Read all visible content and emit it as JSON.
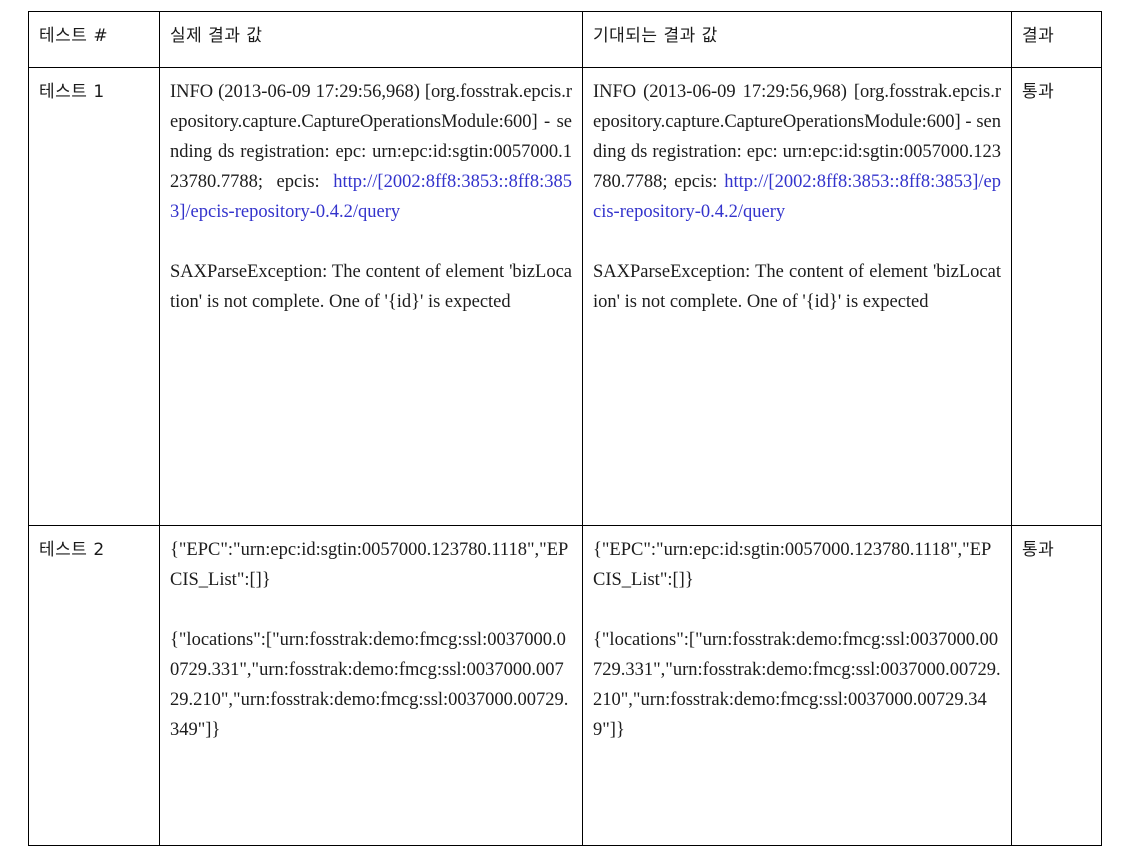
{
  "table": {
    "headers": {
      "test_number": "테스트 #",
      "actual_result": "실제 결과 값",
      "expected_result": "기대되는 결과 값",
      "result": "결과"
    },
    "rows": [
      {
        "test_number": "테스트 1",
        "result": "통과",
        "actual": {
          "block1_pre": "INFO (2013-06-09 17:29:56,968) [org.fosstrak.epcis.repository.capture.CaptureOperationsModule:600] - sending ds registration: epc: urn:epc:id:sgtin:0057000.123780.7788; epcis: ",
          "block1_link": "http://[2002:8ff8:3853::8ff8:3853]/epcis-repository-0.4.2/query",
          "block2": "SAXParseException: The content of element 'bizLocation' is not complete. One of '{id}' is expected"
        },
        "expected": {
          "block1_pre": "INFO (2013-06-09 17:29:56,968) [org.fosstrak.epcis.repository.capture.CaptureOperationsModule:600] - sending ds registration: epc: urn:epc:id:sgtin:0057000.123780.7788; epcis: ",
          "block1_link": "http://[2002:8ff8:3853::8ff8:3853]/epcis-repository-0.4.2/query",
          "block2": "SAXParseException: The content of element 'bizLocation' is not complete. One of '{id}' is expected"
        }
      },
      {
        "test_number": "테스트 2",
        "result": "통과",
        "actual": {
          "block1": "{\"EPC\":\"urn:epc:id:sgtin:0057000.123780.1118\",\"EPCIS_List\":[]}",
          "block2": "{\"locations\":[\"urn:fosstrak:demo:fmcg:ssl:0037000.00729.331\",\"urn:fosstrak:demo:fmcg:ssl:0037000.00729.210\",\"urn:fosstrak:demo:fmcg:ssl:0037000.00729.349\"]}"
        },
        "expected": {
          "block1": "{\"EPC\":\"urn:epc:id:sgtin:0057000.123780.1118\",\"EPCIS_List\":[]}",
          "block2": "{\"locations\":[\"urn:fosstrak:demo:fmcg:ssl:0037000.00729.331\",\"urn:fosstrak:demo:fmcg:ssl:0037000.00729.210\",\"urn:fosstrak:demo:fmcg:ssl:0037000.00729.349\"]}"
        }
      }
    ]
  },
  "colors": {
    "link": "#3333cc",
    "border": "#000000",
    "text": "#1c1c1c",
    "background": "#ffffff"
  }
}
